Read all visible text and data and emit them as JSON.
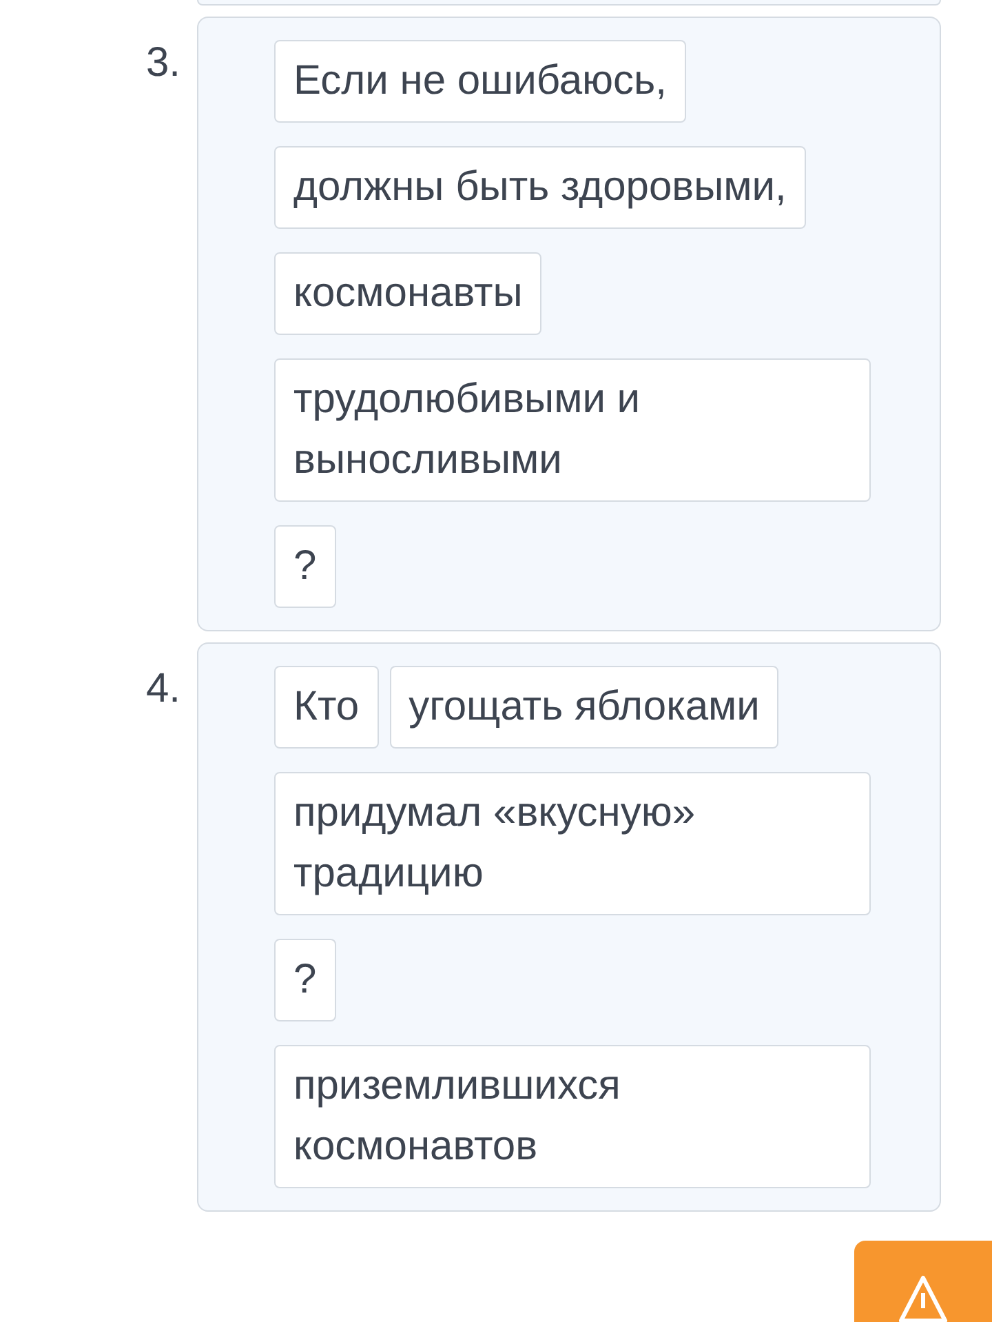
{
  "questions": [
    {
      "number": "3.",
      "rows": [
        [
          "Если не ошибаюсь,"
        ],
        [
          "должны быть здоровыми,"
        ],
        [
          "космонавты"
        ],
        [
          "трудолюбивыми и выносливыми"
        ],
        [
          "?"
        ]
      ]
    },
    {
      "number": "4.",
      "rows": [
        [
          "Кто",
          "угощать яблоками"
        ],
        [
          "придумал «вкусную» традицию"
        ],
        [
          "?"
        ],
        [
          "приземлившихся космонавтов"
        ]
      ]
    }
  ]
}
